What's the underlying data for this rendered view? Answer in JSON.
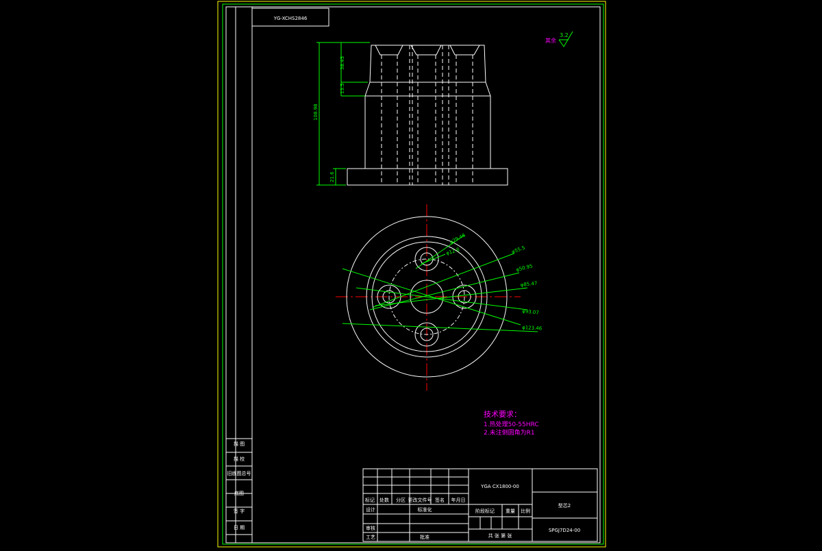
{
  "title_code": "YG-XCHS2846",
  "roughness": {
    "label": "其余",
    "value": "3.2"
  },
  "dimensions": {
    "height_total": "108.98",
    "height_top": "38.45",
    "height_step": "13.5",
    "height_flange": "21.6",
    "d_hole_pcd": "φ29.46",
    "d_hole": "φ12.8",
    "d_55": "φ55.5",
    "d_50": "φ50.95",
    "d_85": "φ85.47",
    "d_93": "φ93.07",
    "d_123": "φ123.46"
  },
  "tech_requirements": {
    "heading": "技术要求：",
    "line1": "1.热处理50-55HRC",
    "line2": "2.未注倒圆角为R1"
  },
  "side_stamp": [
    "描 图",
    "描 校",
    "旧底图总号",
    "底图",
    "签 字",
    "日 期"
  ],
  "title_block": {
    "header_row": [
      "标记",
      "处数",
      "分区",
      "更改文件号",
      "签名",
      "年月日"
    ],
    "design": "设计",
    "standardize": "标准化",
    "review": "审核",
    "process": "工艺",
    "approve": "批准",
    "drawing_no": "YGA CX1800-00",
    "stage_mark": "阶段标记",
    "weight": "重量",
    "scale": "比例",
    "sheets": "共 张 第 张",
    "part_name": "型芯2",
    "material": "SPGJ7D24-00"
  },
  "colors": {
    "line": "#ffffff",
    "dim": "#00ff00",
    "center": "#ff0000",
    "text": "#ff00ff",
    "border": "#ffff00"
  }
}
